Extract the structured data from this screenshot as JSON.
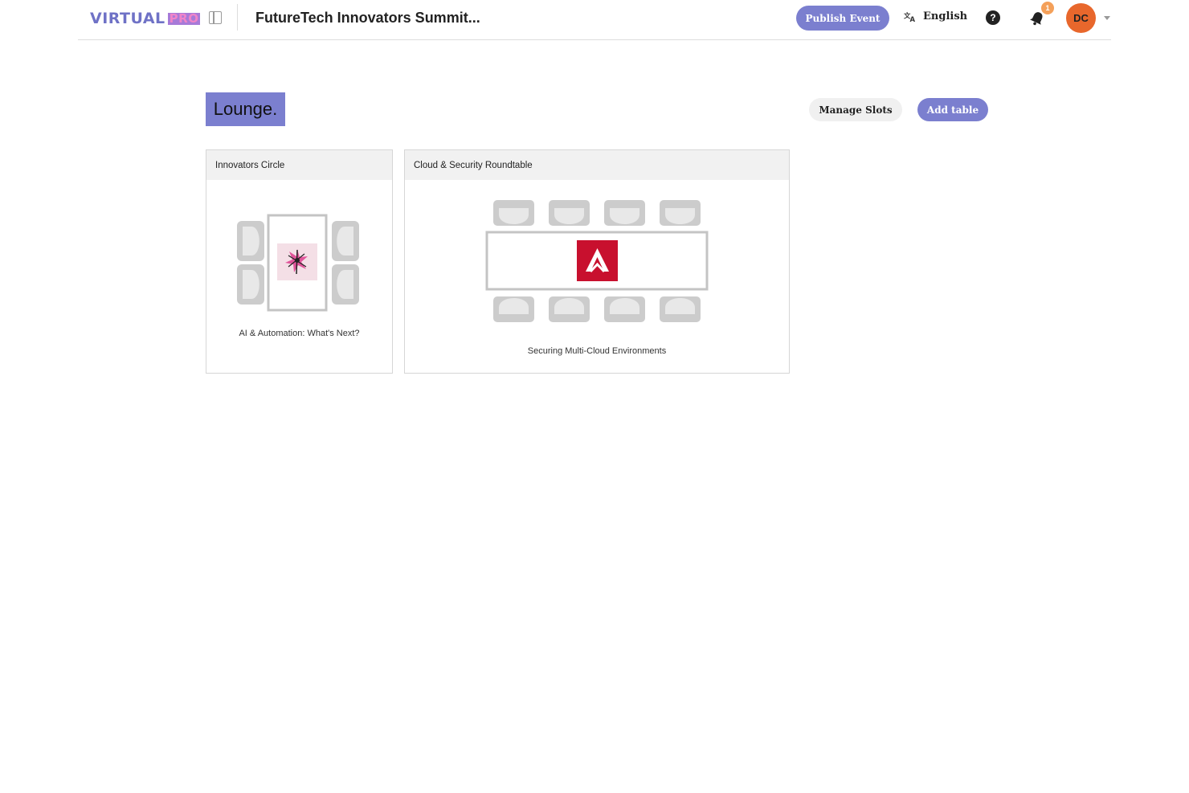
{
  "header": {
    "logo_virtual": "VIRTUAL",
    "logo_pro": "PRO",
    "event_title": "FutureTech Innovators Summit...",
    "publish_label": "Publish Event",
    "language_label": "English",
    "help_label": "?",
    "notification_count": "1",
    "user_initials": "DC"
  },
  "page": {
    "title": "Lounge.",
    "manage_slots_label": "Manage Slots",
    "add_table_label": "Add table"
  },
  "tables": [
    {
      "name": "Innovators Circle",
      "topic": "AI & Automation: What's Next?",
      "logo_icon": "floral-logo-icon"
    },
    {
      "name": "Cloud & Security Roundtable",
      "topic": "Securing Multi-Cloud Environments",
      "logo_icon": "red-a-logo-icon"
    }
  ],
  "colors": {
    "accent": "#7b7fcf",
    "avatar": "#e8672c",
    "badge": "#f4a05a",
    "chair": "#cccccc",
    "logo_red": "#c8102e"
  }
}
